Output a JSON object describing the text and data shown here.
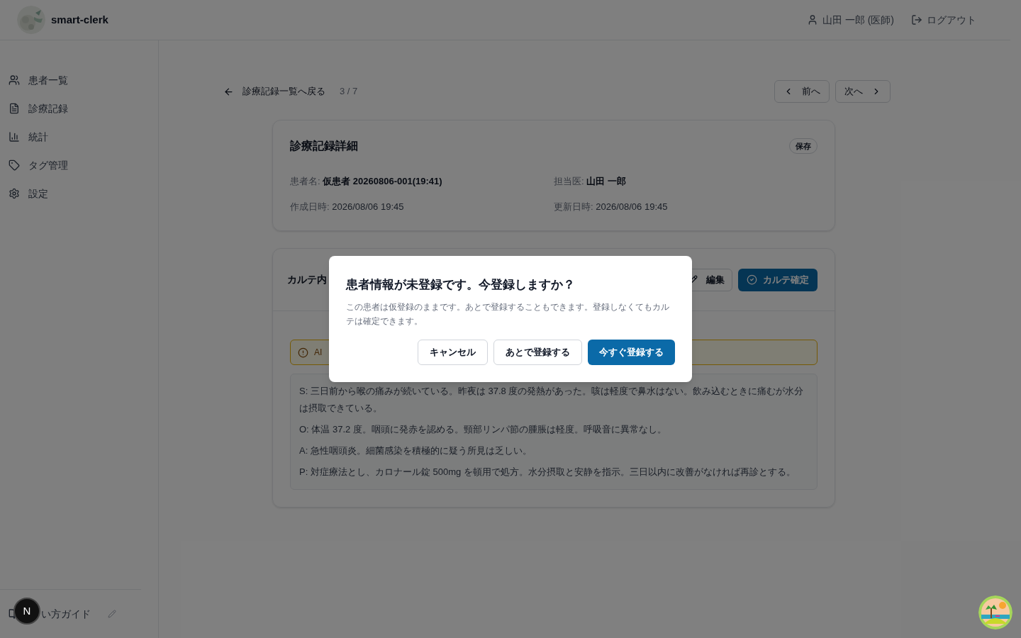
{
  "header": {
    "app_name": "smart-clerk",
    "user": "山田 一郎 (医師)",
    "logout": "ログアウト"
  },
  "sidebar": {
    "items": [
      {
        "label": "患者一覧",
        "kind": "patients"
      },
      {
        "label": "診療記録",
        "kind": "records"
      },
      {
        "label": "統計",
        "kind": "stats"
      },
      {
        "label": "タグ管理",
        "kind": "tags"
      },
      {
        "label": "設定",
        "kind": "settings"
      }
    ],
    "guide": "い方ガイド"
  },
  "nav": {
    "back": "診療記録一覧へ戻る",
    "position": "3 / 7",
    "prev": "前へ",
    "next": "次へ"
  },
  "record": {
    "title": "診療記録詳細",
    "badge": "保存",
    "fields": [
      {
        "label": "患者名:",
        "value": "仮患者 20260806-001(19:41)",
        "emphasis": true
      },
      {
        "label": "担当医:",
        "value": "山田 一郎",
        "emphasis": true
      },
      {
        "label": "作成日時:",
        "value": "2026/08/06 19:45",
        "emphasis": false
      },
      {
        "label": "更新日時:",
        "value": "2026/08/06 19:45",
        "emphasis": false
      }
    ]
  },
  "karte": {
    "title": "カルテ内",
    "edit": "編集",
    "confirm": "カルテ確定",
    "alert": "AI",
    "lines": [
      "S: 三日前から喉の痛みが続いている。昨夜は 37.8 度の発熱があった。咳は軽度で鼻水はない。飲み込むときに痛むが水分は摂取できている。",
      "O: 体温 37.2 度。咽頭に発赤を認める。頸部リンパ節の腫脹は軽度。呼吸音に異常なし。",
      "A: 急性咽頭炎。細菌感染を積極的に疑う所見は乏しい。",
      "P: 対症療法とし、カロナール錠 500mg を頓用で処方。水分摂取と安静を指示。三日以内に改善がなければ再診とする。"
    ]
  },
  "dialog": {
    "title": "患者情報が未登録です。今登録しますか？",
    "message": "この患者は仮登録のままです。あとで登録することもできます。登録しなくてもカルテは確定できます。",
    "buttons": [
      {
        "label": "キャンセル",
        "kind": "secondary"
      },
      {
        "label": "あとで登録する",
        "kind": "secondary"
      },
      {
        "label": "今すぐ登録する",
        "kind": "primary"
      }
    ]
  },
  "dev_badge": "N"
}
